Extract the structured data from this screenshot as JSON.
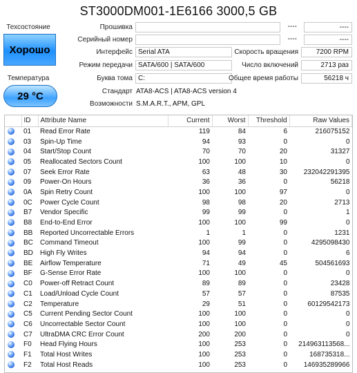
{
  "title": "ST3000DM001-1E6166 3000,5 GB",
  "health": {
    "label": "Техсостояние",
    "status": "Хорошо"
  },
  "temperature": {
    "label": "Температура",
    "value": "29 °C"
  },
  "fields": {
    "firmware_label": "Прошивка",
    "firmware_value": "",
    "serial_label": "Серийный номер",
    "serial_value": "",
    "interface_label": "Интерфейс",
    "interface_value": "Serial ATA",
    "transfer_label": "Режим передачи",
    "transfer_value": "SATA/600 | SATA/600",
    "volume_label": "Буква тома",
    "volume_value": "C:",
    "standard_label": "Стандарт",
    "standard_value": "ATA8-ACS | ATA8-ACS version 4",
    "features_label": "Возможности",
    "features_value": "S.M.A.R.T., APM, GPL"
  },
  "right_fields": {
    "blank1_a": "----",
    "blank1_b": "----",
    "blank2_a": "----",
    "blank2_b": "----",
    "rpm_label": "Скорость вращения",
    "rpm_value": "7200 RPM",
    "power_count_label": "Число включений",
    "power_count_value": "2713 раз",
    "power_hours_label": "Общее время работы",
    "power_hours_value": "56218 ч"
  },
  "table": {
    "headers": [
      "",
      "ID",
      "Attribute Name",
      "Current",
      "Worst",
      "Threshold",
      "Raw Values"
    ],
    "rows": [
      [
        "01",
        "Read Error Rate",
        "119",
        "84",
        "6",
        "216075152"
      ],
      [
        "03",
        "Spin-Up Time",
        "94",
        "93",
        "0",
        "0"
      ],
      [
        "04",
        "Start/Stop Count",
        "70",
        "70",
        "20",
        "31327"
      ],
      [
        "05",
        "Reallocated Sectors Count",
        "100",
        "100",
        "10",
        "0"
      ],
      [
        "07",
        "Seek Error Rate",
        "63",
        "48",
        "30",
        "232042291395"
      ],
      [
        "09",
        "Power-On Hours",
        "36",
        "36",
        "0",
        "56218"
      ],
      [
        "0A",
        "Spin Retry Count",
        "100",
        "100",
        "97",
        "0"
      ],
      [
        "0C",
        "Power Cycle Count",
        "98",
        "98",
        "20",
        "2713"
      ],
      [
        "B7",
        "Vendor Specific",
        "99",
        "99",
        "0",
        "1"
      ],
      [
        "B8",
        "End-to-End Error",
        "100",
        "100",
        "99",
        "0"
      ],
      [
        "BB",
        "Reported Uncorrectable Errors",
        "1",
        "1",
        "0",
        "1231"
      ],
      [
        "BC",
        "Command Timeout",
        "100",
        "99",
        "0",
        "4295098430"
      ],
      [
        "BD",
        "High Fly Writes",
        "94",
        "94",
        "0",
        "6"
      ],
      [
        "BE",
        "Airflow Temperature",
        "71",
        "49",
        "45",
        "504561693"
      ],
      [
        "BF",
        "G-Sense Error Rate",
        "100",
        "100",
        "0",
        "0"
      ],
      [
        "C0",
        "Power-off Retract Count",
        "89",
        "89",
        "0",
        "23428"
      ],
      [
        "C1",
        "Load/Unload Cycle Count",
        "57",
        "57",
        "0",
        "87535"
      ],
      [
        "C2",
        "Temperature",
        "29",
        "51",
        "0",
        "60129542173"
      ],
      [
        "C5",
        "Current Pending Sector Count",
        "100",
        "100",
        "0",
        "0"
      ],
      [
        "C6",
        "Uncorrectable Sector Count",
        "100",
        "100",
        "0",
        "0"
      ],
      [
        "C7",
        "UltraDMA CRC Error Count",
        "200",
        "200",
        "0",
        "0"
      ],
      [
        "F0",
        "Head Flying Hours",
        "100",
        "253",
        "0",
        "214963113568..."
      ],
      [
        "F1",
        "Total Host Writes",
        "100",
        "253",
        "0",
        "168735318..."
      ],
      [
        "F2",
        "Total Host Reads",
        "100",
        "253",
        "0",
        "146935289966"
      ]
    ]
  },
  "colors": {
    "status_good": "#1e90ff",
    "dot": "#2f6fe0"
  }
}
